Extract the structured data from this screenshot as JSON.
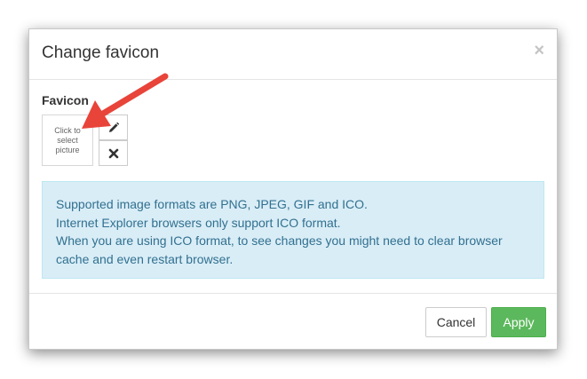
{
  "dialog": {
    "title": "Change favicon",
    "close_glyph": "×"
  },
  "favicon": {
    "label": "Favicon",
    "picture_placeholder": "Click to select picture",
    "edit_icon": "pencil-icon",
    "remove_icon": "remove-x-icon"
  },
  "info": {
    "lines": [
      "Supported image formats are PNG, JPEG, GIF and ICO.",
      "Internet Explorer browsers only support ICO format.",
      "When you are using ICO format, to see changes you might need to clear browser cache and even restart browser."
    ]
  },
  "footer": {
    "cancel_label": "Cancel",
    "apply_label": "Apply"
  },
  "annotation": {
    "arrow_color": "#e8443a"
  },
  "colors": {
    "info_background": "#d9edf7",
    "info_text": "#31708f",
    "apply_green": "#5cb85c"
  }
}
